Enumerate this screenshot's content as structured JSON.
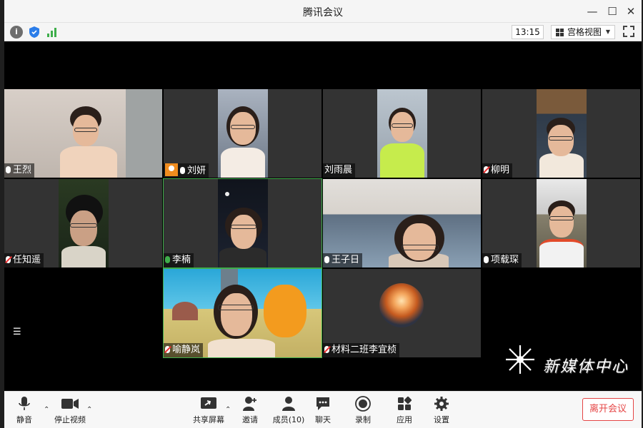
{
  "window": {
    "title": "腾讯会议",
    "minimize": "—",
    "maximize": "☐",
    "close": "✕"
  },
  "toolbar": {
    "time": "13:15",
    "view_label": "宫格视图"
  },
  "participants": [
    {
      "name": "王烈",
      "mic": "on",
      "host": false
    },
    {
      "name": "刘妍",
      "mic": "on",
      "host": true
    },
    {
      "name": "刘雨晨",
      "mic": "none",
      "host": false
    },
    {
      "name": "柳明",
      "mic": "muted",
      "host": false
    },
    {
      "name": "任知遥",
      "mic": "muted",
      "host": false
    },
    {
      "name": "李楠",
      "mic": "active",
      "host": false
    },
    {
      "name": "王子日",
      "mic": "on",
      "host": false
    },
    {
      "name": "项载琛",
      "mic": "on",
      "host": false
    },
    {
      "name": "喻静岚",
      "mic": "muted",
      "host": false
    },
    {
      "name": "材料二班李宜桢",
      "mic": "muted",
      "host": false
    }
  ],
  "watermark": {
    "text": "新媒体中心"
  },
  "bottombar": {
    "mute_label": "静音",
    "video_label": "停止视频",
    "share_label": "共享屏幕",
    "invite_label": "邀请",
    "members_label": "成员(10)",
    "chat_label": "聊天",
    "record_label": "录制",
    "apps_label": "应用",
    "settings_label": "设置",
    "leave_label": "离开会议"
  },
  "colors": {
    "accent_green": "#3fae4b",
    "leave_red": "#e54545",
    "host_orange": "#f08c1e"
  }
}
